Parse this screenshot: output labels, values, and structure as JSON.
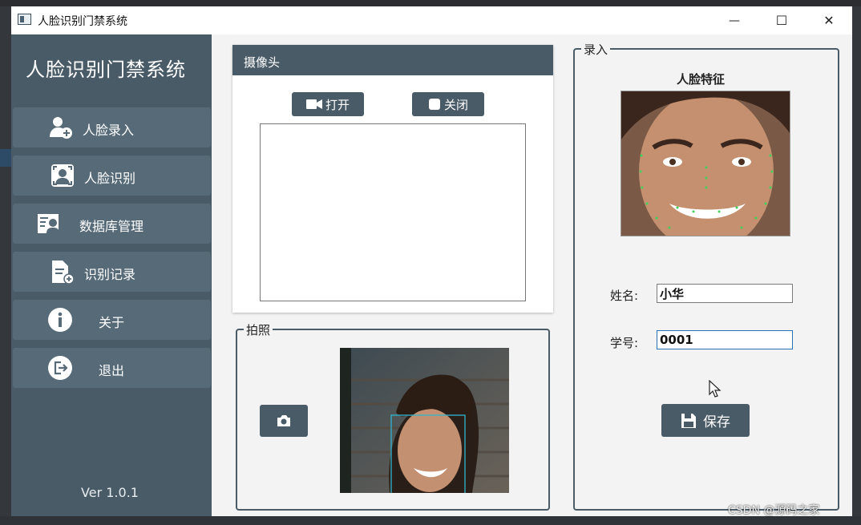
{
  "window": {
    "title": "人脸识别门禁系统"
  },
  "titlebar_buttons": {
    "minimize": "—",
    "maximize": "☐",
    "close": "✕"
  },
  "sidebar": {
    "brand": "人脸识别门禁系统",
    "items": [
      {
        "label": "人脸录入",
        "icon": "user-add-icon"
      },
      {
        "label": "人脸识别",
        "icon": "face-scan-icon"
      },
      {
        "label": "数据库管理",
        "icon": "database-user-icon"
      },
      {
        "label": "识别记录",
        "icon": "document-add-icon"
      },
      {
        "label": "关于",
        "icon": "info-icon"
      },
      {
        "label": "退出",
        "icon": "exit-icon"
      }
    ],
    "version": "Ver 1.0.1"
  },
  "camera": {
    "title": "摄像头",
    "open_label": "打开",
    "close_label": "关闭"
  },
  "photo": {
    "title": "拍照",
    "capture_icon": "camera-icon"
  },
  "enroll": {
    "title": "录入",
    "feature_label": "人脸特征",
    "name_label": "姓名:",
    "name_value": "小华",
    "id_label": "学号:",
    "id_value": "0001",
    "save_label": "保存"
  },
  "watermark": "CSDN @源码之家",
  "colors": {
    "sidebar": "#4a5b68",
    "nav_item": "#566a78",
    "accent_focus": "#2a6fb0"
  }
}
